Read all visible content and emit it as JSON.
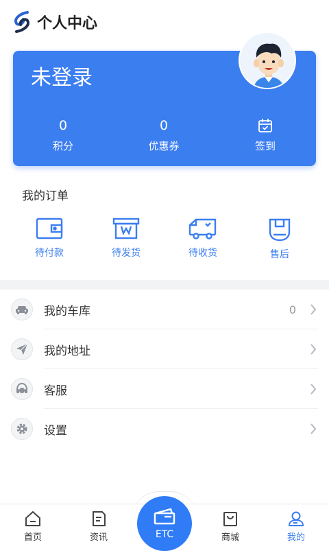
{
  "header": {
    "title": "个人中心",
    "logo_icon": "app-logo-icon"
  },
  "profile": {
    "login_status": "未登录",
    "avatar_icon": "user-avatar",
    "stats": [
      {
        "value": "0",
        "label": "积分"
      },
      {
        "value": "0",
        "label": "优惠券"
      },
      {
        "icon": "calendar-check-icon",
        "label": "签到"
      }
    ]
  },
  "orders": {
    "title": "我的订单",
    "items": [
      {
        "label": "待付款",
        "icon": "wallet-icon"
      },
      {
        "label": "待发货",
        "icon": "box-icon"
      },
      {
        "label": "待收货",
        "icon": "truck-icon"
      },
      {
        "label": "售后",
        "icon": "aftersale-icon"
      }
    ]
  },
  "menu": [
    {
      "label": "我的车库",
      "value": "0",
      "icon": "car-icon"
    },
    {
      "label": "我的地址",
      "value": "",
      "icon": "send-icon"
    },
    {
      "label": "客服",
      "value": "",
      "icon": "headset-icon"
    },
    {
      "label": "设置",
      "value": "",
      "icon": "gear-icon"
    }
  ],
  "tabs": [
    {
      "label": "首页",
      "icon": "home-icon"
    },
    {
      "label": "资讯",
      "icon": "news-icon"
    },
    {
      "label": "ETC",
      "icon": "etc-card-icon"
    },
    {
      "label": "商城",
      "icon": "bag-icon"
    },
    {
      "label": "我的",
      "icon": "user-icon",
      "active": true
    }
  ],
  "colors": {
    "primary": "#3b7ef0",
    "divider": "#f2f3f5"
  }
}
